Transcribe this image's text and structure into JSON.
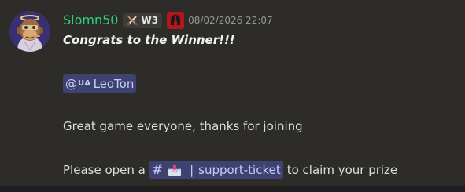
{
  "message": {
    "author": {
      "name": "Slomn50",
      "tag": "W3",
      "avatar_icon": "ape-avatar-icon",
      "tag_icon": "crossed-swords-icon",
      "badge_icon": "spartan-helmet-icon"
    },
    "timestamp": "08/02/2026 22:07",
    "lines": {
      "title": "Congrats to the Winner!!!",
      "closing": "Great game everyone, thanks for joining",
      "instruction_before": "Please open a",
      "instruction_after": "to claim your prize"
    },
    "mention": {
      "at": "@",
      "flag": "UA",
      "name": "LeoTon"
    },
    "channel": {
      "hash": "#",
      "icon": "inbox-tray-icon",
      "separator": "|",
      "name": "support-ticket"
    }
  },
  "colors": {
    "username": "#2fcf7a",
    "mention_bg": "#3d4270",
    "mention_text": "#c9cdfb",
    "badge_bg": "#b3171d"
  }
}
